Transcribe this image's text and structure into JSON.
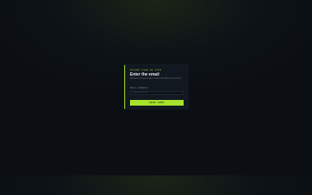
{
  "card": {
    "eyebrow": "SECURE SIGN-IN STEP",
    "title": "Enter the email",
    "description": "We'll send a one-time sign-in code to the address you provide.",
    "email_label": "EMAIL ADDRESS",
    "email_value": "",
    "email_placeholder": "you@example.com",
    "submit_label": "SEND CODE"
  },
  "colors": {
    "accent": "#a6e22e",
    "background": "#0b0f13",
    "card": "#121820"
  }
}
